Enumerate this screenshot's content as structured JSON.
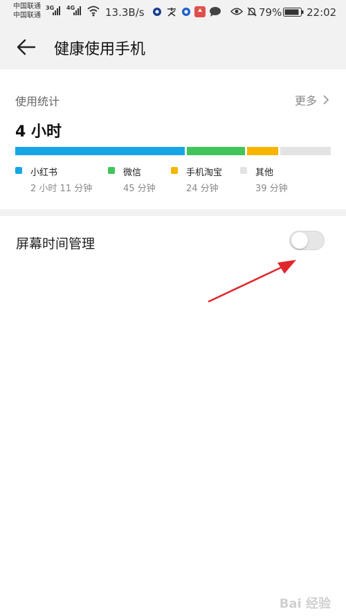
{
  "status_bar": {
    "carrier_1": "中国联通",
    "carrier_2": "中国联通",
    "net_1": "3G",
    "net_2": "4G",
    "speed": "13.3B/s",
    "battery": "79%",
    "time": "22:02"
  },
  "header": {
    "title": "健康使用手机",
    "back_icon": "arrow-left-icon"
  },
  "usage": {
    "section_title": "使用统计",
    "more_label": "更多",
    "total": "4 小时",
    "apps": [
      {
        "name": "小红书",
        "duration": "2 小时 11 分钟",
        "color": "#16a6e6",
        "minutes": 131
      },
      {
        "name": "微信",
        "duration": "45 分钟",
        "color": "#41c459",
        "minutes": 45
      },
      {
        "name": "手机淘宝",
        "duration": "24 分钟",
        "color": "#f7b500",
        "minutes": 24
      },
      {
        "name": "其他",
        "duration": "39 分钟",
        "color": "#e3e3e3",
        "minutes": 39
      }
    ]
  },
  "screen_time": {
    "label": "屏幕时间管理",
    "enabled": false
  },
  "annotation_color": "#e0262a",
  "watermark": "Bai 经验"
}
